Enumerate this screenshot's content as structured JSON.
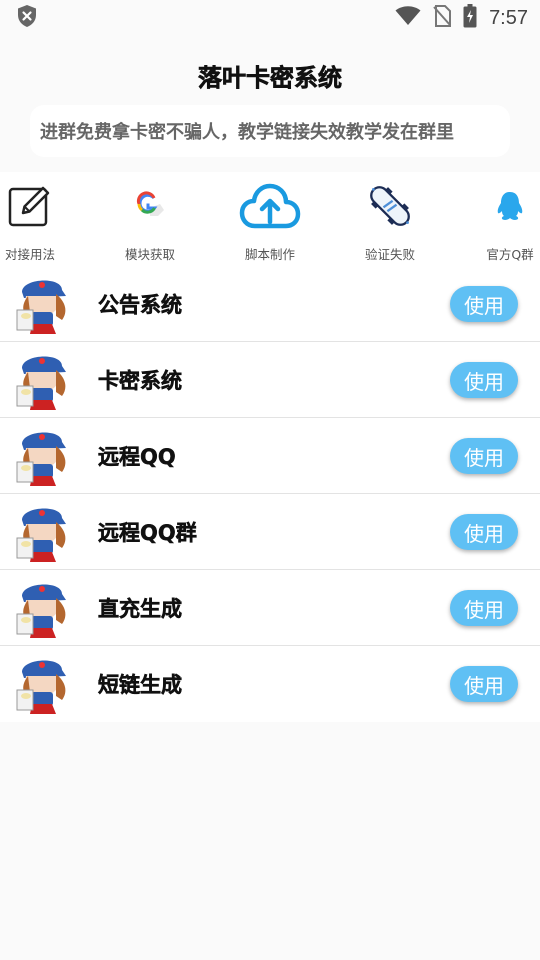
{
  "status": {
    "time": "7:57"
  },
  "header": {
    "title": "落叶卡密系统"
  },
  "notice": {
    "text": "进群免费拿卡密不骗人，教学链接失效教学发在群里"
  },
  "shortcuts": [
    {
      "label": "对接用法",
      "icon": "edit-icon"
    },
    {
      "label": "模块获取",
      "icon": "google-icon"
    },
    {
      "label": "脚本制作",
      "icon": "cloud-upload-icon"
    },
    {
      "label": "验证失败",
      "icon": "skateboard-icon"
    },
    {
      "label": "官方Q群",
      "icon": "qq-icon"
    }
  ],
  "items": [
    {
      "title": "公告系统",
      "button": "使用"
    },
    {
      "title": "卡密系统",
      "button": "使用"
    },
    {
      "title": "远程QQ",
      "button": "使用"
    },
    {
      "title": "远程QQ群",
      "button": "使用"
    },
    {
      "title": "直充生成",
      "button": "使用"
    },
    {
      "title": "短链生成",
      "button": "使用"
    }
  ],
  "colors": {
    "accent": "#5fc0f4",
    "cloud": "#1a9ae0",
    "qq": "#2aa7ec"
  }
}
